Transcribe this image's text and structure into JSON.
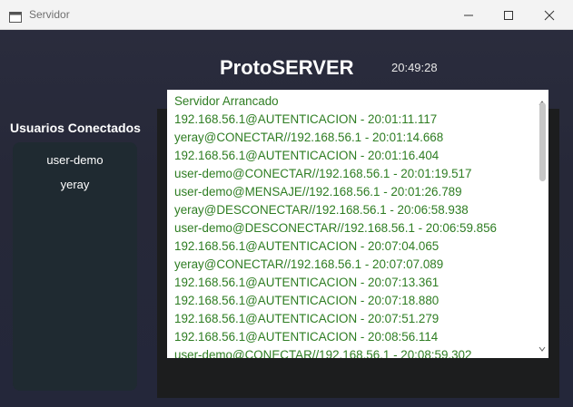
{
  "window": {
    "title": "Servidor"
  },
  "header": {
    "title": "ProtoSERVER",
    "clock": "20:49:28"
  },
  "users": {
    "heading": "Usuarios Conectados",
    "items": [
      "user-demo",
      "yeray"
    ]
  },
  "log": {
    "lines": [
      "Servidor Arrancado",
      "192.168.56.1@AUTENTICACION - 20:01:11.117",
      "yeray@CONECTAR//192.168.56.1 - 20:01:14.668",
      "192.168.56.1@AUTENTICACION - 20:01:16.404",
      "user-demo@CONECTAR//192.168.56.1 - 20:01:19.517",
      "user-demo@MENSAJE//192.168.56.1 - 20:01:26.789",
      "yeray@DESCONECTAR//192.168.56.1 - 20:06:58.938",
      "user-demo@DESCONECTAR//192.168.56.1 - 20:06:59.856",
      "192.168.56.1@AUTENTICACION - 20:07:04.065",
      "yeray@CONECTAR//192.168.56.1 - 20:07:07.089",
      "192.168.56.1@AUTENTICACION - 20:07:13.361",
      "192.168.56.1@AUTENTICACION - 20:07:18.880",
      "192.168.56.1@AUTENTICACION - 20:07:51.279",
      "192.168.56.1@AUTENTICACION - 20:08:56.114",
      "user-demo@CONECTAR//192.168.56.1 - 20:08:59.302"
    ]
  },
  "colors": {
    "background": "#262838",
    "users_panel": "#1f2a31",
    "log_text": "#2e7d22"
  },
  "icons": {
    "app": "window-icon",
    "minimize": "minimize-icon",
    "maximize": "maximize-icon",
    "close": "close-icon",
    "scroll_up": "scroll-up-arrow-icon",
    "scroll_down": "scroll-down-arrow-icon"
  }
}
